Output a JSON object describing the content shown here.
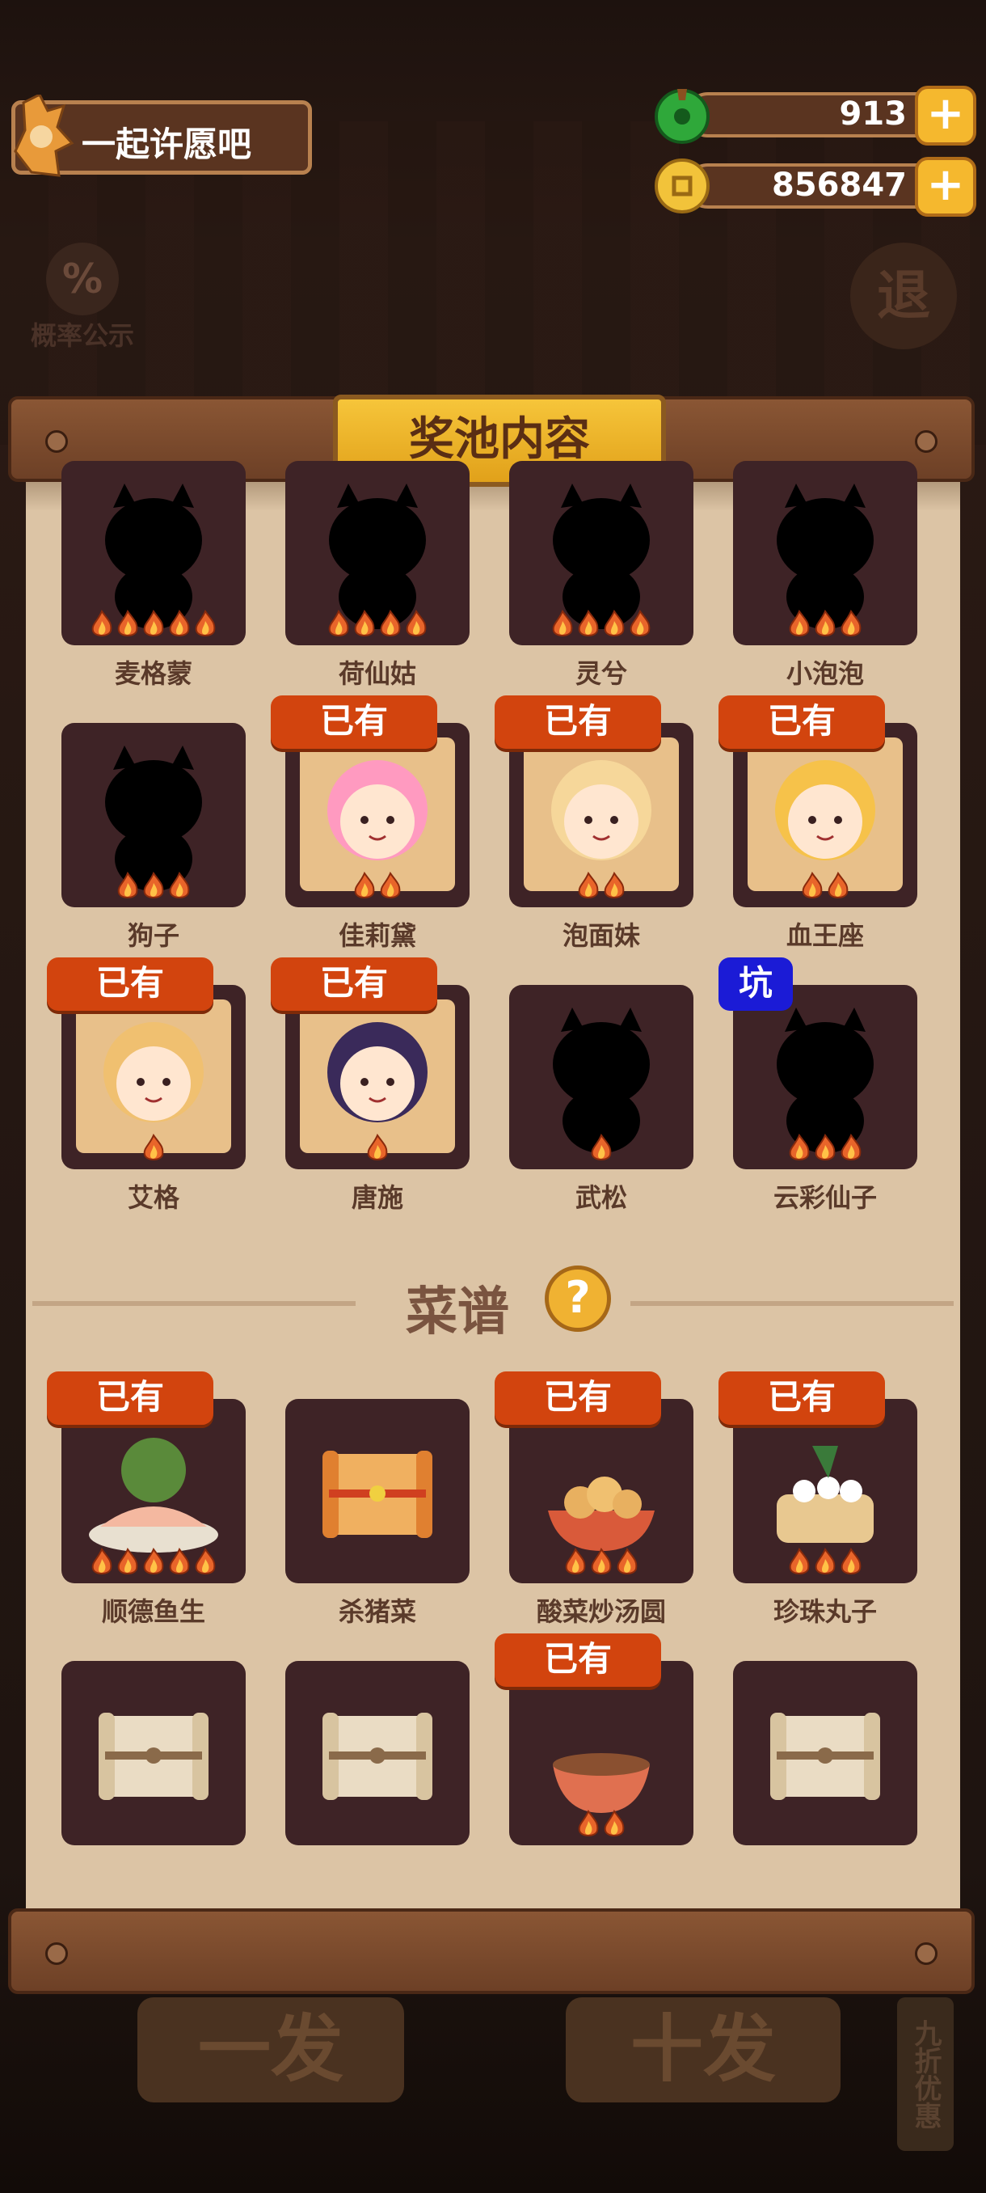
{
  "header": {
    "event_title": "一起许愿吧",
    "jade_amount": "913",
    "coin_amount": "856847",
    "plus_label": "+",
    "prob_icon_text": "%",
    "prob_label": "概率公示",
    "exit_label": "退"
  },
  "panel": {
    "title": "奖池内容"
  },
  "characters": [
    {
      "name": "麦格蒙",
      "owned": false,
      "flames": 5,
      "tag": ""
    },
    {
      "name": "荷仙姑",
      "owned": false,
      "flames": 4,
      "tag": ""
    },
    {
      "name": "灵兮",
      "owned": false,
      "flames": 4,
      "tag": ""
    },
    {
      "name": "小泡泡",
      "owned": false,
      "flames": 3,
      "tag": ""
    },
    {
      "name": "狗子",
      "owned": false,
      "flames": 3,
      "tag": ""
    },
    {
      "name": "佳莉黛",
      "owned": true,
      "flames": 2,
      "tag": "已有"
    },
    {
      "name": "泡面妹",
      "owned": true,
      "flames": 2,
      "tag": "已有"
    },
    {
      "name": "血王座",
      "owned": true,
      "flames": 2,
      "tag": "已有"
    },
    {
      "name": "艾格",
      "owned": true,
      "flames": 1,
      "tag": "已有"
    },
    {
      "name": "唐施",
      "owned": true,
      "flames": 1,
      "tag": "已有"
    },
    {
      "name": "武松",
      "owned": false,
      "flames": 1,
      "tag": ""
    },
    {
      "name": "云彩仙子",
      "owned": false,
      "flames": 3,
      "tag": "坑"
    }
  ],
  "recipes_section": {
    "title": "菜谱",
    "help_icon": "?"
  },
  "recipes": [
    {
      "name": "顺德鱼生",
      "flames": 5,
      "tag": "已有",
      "icon": "fish-platter"
    },
    {
      "name": "杀猪菜",
      "flames": 0,
      "tag": "",
      "icon": "scroll-gold"
    },
    {
      "name": "酸菜炒汤圆",
      "flames": 3,
      "tag": "已有",
      "icon": "dumpling-bowl"
    },
    {
      "name": "珍珠丸子",
      "flames": 3,
      "tag": "已有",
      "icon": "steamer"
    },
    {
      "name": "",
      "flames": 0,
      "tag": "",
      "icon": "scroll"
    },
    {
      "name": "",
      "flames": 0,
      "tag": "",
      "icon": "scroll"
    },
    {
      "name": "",
      "flames": 2,
      "tag": "已有",
      "icon": "soup-bowl"
    },
    {
      "name": "",
      "flames": 0,
      "tag": "",
      "icon": "scroll"
    }
  ],
  "bottom": {
    "draw_one": "一发",
    "draw_ten": "十发",
    "discount": "九折优惠"
  },
  "colors": {
    "tag_owned": "#d2440e",
    "tag_pit": "#1b1bd6",
    "card_bg": "#3e2326",
    "paper": "#dcc4a5",
    "gold": "#f5b82e"
  }
}
